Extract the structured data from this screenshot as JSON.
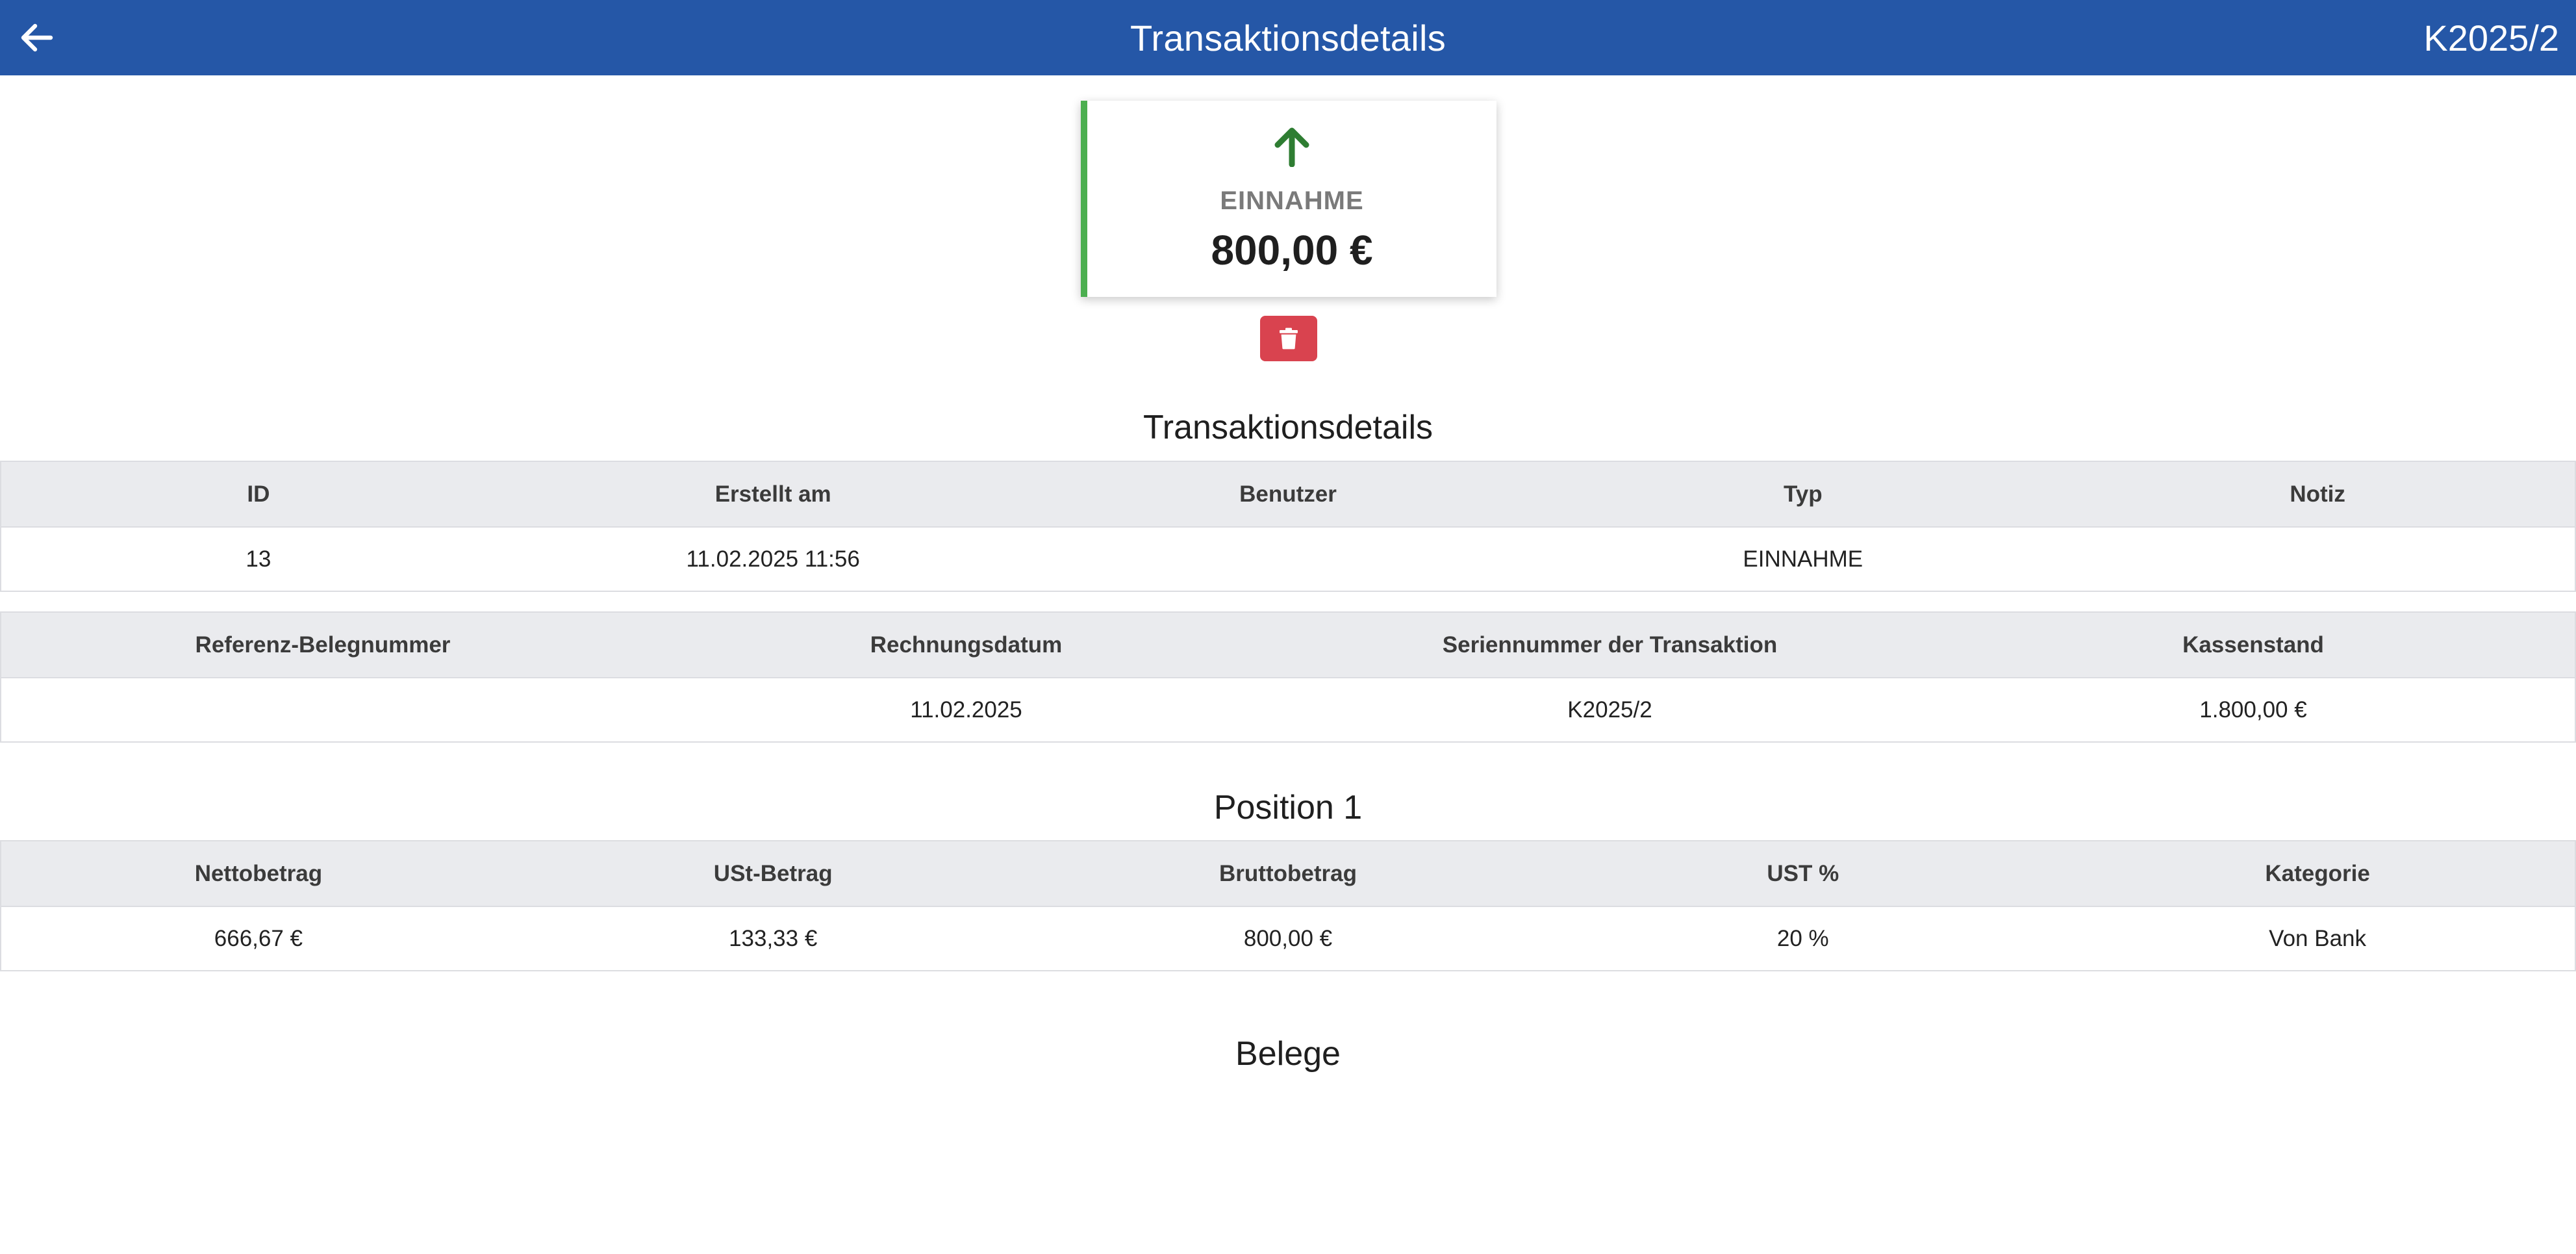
{
  "appbar": {
    "title": "Transaktionsdetails",
    "reference": "K2025/2",
    "back_icon": "arrow-left-icon",
    "color": "#2557a7"
  },
  "summary": {
    "icon": "arrow-up-icon",
    "icon_color": "#2e7d32",
    "accent_color": "#4caf50",
    "type": "EINNAHME",
    "amount": "800,00 €"
  },
  "delete_button": {
    "icon": "trash-icon",
    "color": "#d9434f"
  },
  "details": {
    "title": "Transaktionsdetails",
    "table1": {
      "headers": [
        "ID",
        "Erstellt am",
        "Benutzer",
        "Typ",
        "Notiz"
      ],
      "row": [
        "13",
        "11.02.2025 11:56",
        "",
        "EINNAHME",
        ""
      ]
    },
    "table2": {
      "headers": [
        "Referenz-Belegnummer",
        "Rechnungsdatum",
        "Seriennummer der Transaktion",
        "Kassenstand"
      ],
      "row": [
        "",
        "11.02.2025",
        "K2025/2",
        "1.800,00 €"
      ]
    }
  },
  "position": {
    "title": "Position 1",
    "headers": [
      "Nettobetrag",
      "USt-Betrag",
      "Bruttobetrag",
      "UST %",
      "Kategorie"
    ],
    "row": [
      "666,67 €",
      "133,33 €",
      "800,00 €",
      "20 %",
      "Von Bank"
    ]
  },
  "receipts": {
    "title": "Belege"
  }
}
